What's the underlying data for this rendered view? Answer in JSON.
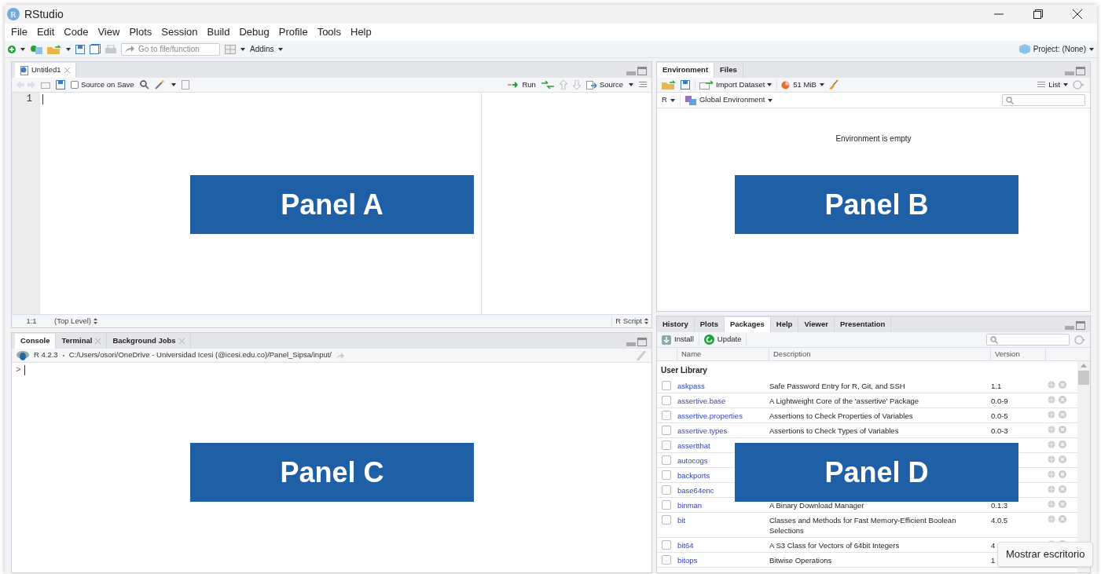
{
  "window": {
    "title": "RStudio",
    "logo": "R"
  },
  "menu": [
    "File",
    "Edit",
    "Code",
    "View",
    "Plots",
    "Session",
    "Build",
    "Debug",
    "Profile",
    "Tools",
    "Help"
  ],
  "toolbar": {
    "search_placeholder": "Go to file/function",
    "addins": "Addins",
    "project": "Project: (None)"
  },
  "source_pane": {
    "tabs": [
      {
        "label": "Untitled1",
        "selected": true,
        "closable": true
      }
    ],
    "source_on_save": {
      "label": "Source on Save",
      "checked": false
    },
    "run": "Run",
    "source": "Source",
    "line_numbers": [
      "1"
    ],
    "status": {
      "position": "1:1",
      "scope": "(Top Level)",
      "file_type": "R Script"
    }
  },
  "console_pane": {
    "tabs": [
      {
        "label": "Console",
        "selected": true,
        "closable": false
      },
      {
        "label": "Terminal",
        "selected": false,
        "closable": true
      },
      {
        "label": "Background Jobs",
        "selected": false,
        "closable": true
      }
    ],
    "version": "R 4.2.3",
    "path": "C:/Users/osori/OneDrive - Universidad Icesi (@icesi.edu.co)/Panel_Sipsa/input/",
    "prompt": ">"
  },
  "environment_pane": {
    "tabs": [
      {
        "label": "Environment",
        "selected": true
      },
      {
        "label": "Files",
        "selected": false
      }
    ],
    "import": "Import Dataset",
    "memory": "51 MiB",
    "view": "List",
    "language": "R",
    "scope": "Global Environment",
    "empty_message": "Environment is empty"
  },
  "packages_pane": {
    "tabs": [
      {
        "label": "History",
        "selected": false
      },
      {
        "label": "Plots",
        "selected": false
      },
      {
        "label": "Packages",
        "selected": true
      },
      {
        "label": "Help",
        "selected": false
      },
      {
        "label": "Viewer",
        "selected": false
      },
      {
        "label": "Presentation",
        "selected": false
      }
    ],
    "install": "Install",
    "update": "Update",
    "columns": [
      "Name",
      "Description",
      "Version"
    ],
    "group": "User Library",
    "rows": [
      {
        "name": "askpass",
        "description": "Safe Password Entry for R, Git, and SSH",
        "version": "1.1",
        "checked": false
      },
      {
        "name": "assertive.base",
        "description": "A Lightweight Core of the 'assertive' Package",
        "version": "0.0-9",
        "checked": false
      },
      {
        "name": "assertive.properties",
        "description": "Assertions to Check Properties of Variables",
        "version": "0.0-5",
        "checked": false
      },
      {
        "name": "assertive.types",
        "description": "Assertions to Check Types of Variables",
        "version": "0.0-3",
        "checked": false
      },
      {
        "name": "assertthat",
        "checked": false
      },
      {
        "name": "autocogs",
        "checked": false
      },
      {
        "name": "backports",
        "checked": false
      },
      {
        "name": "base64enc",
        "checked": false
      },
      {
        "name": "binman",
        "description": "A Binary Download Manager",
        "version": "0.1.3",
        "checked": false
      },
      {
        "name": "bit",
        "description": "Classes and Methods for Fast Memory-Efficient Boolean Selections",
        "version": "4.0.5",
        "checked": false
      },
      {
        "name": "bit64",
        "description": "A S3 Class for Vectors of 64bit Integers",
        "version": "4",
        "checked": false
      },
      {
        "name": "bitops",
        "description": "Bitwise Operations",
        "version": "1",
        "checked": false
      }
    ]
  },
  "overlay_labels": [
    "Panel A",
    "Panel B",
    "Panel C",
    "Panel D"
  ],
  "tooltip": "Mostrar escritorio"
}
